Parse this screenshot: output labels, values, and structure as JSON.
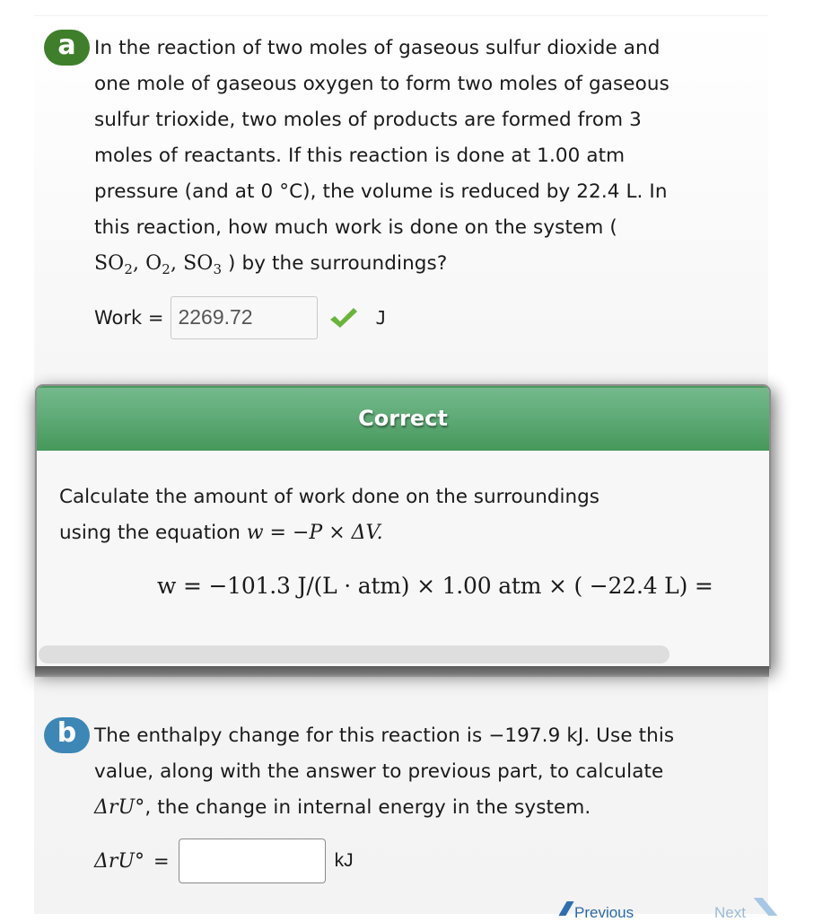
{
  "part_a": {
    "badge": "a",
    "question_lines": [
      "In the reaction of two moles of gaseous sulfur dioxide and",
      "one mole of gaseous oxygen to form two moles of gaseous",
      "sulfur trioxide, two moles of products are formed from 3",
      "moles of reactants. If this reaction is done at 1.00 atm",
      "pressure (and at 0 °C), the volume is reduced by 22.4 L. In",
      "this reaction, how much work is done on the system ("
    ],
    "species": {
      "s1": "SO",
      "s1_sub": "2",
      "s2": "O",
      "s2_sub": "2",
      "s3": "SO",
      "s3_sub": "3",
      "tail": ") by the surroundings?"
    },
    "answer_label": "Work =",
    "answer_value": "2269.72",
    "answer_status": "correct",
    "unit": "J"
  },
  "feedback": {
    "title": "Correct",
    "text_line1": "Calculate the amount of work done on the surroundings",
    "text_line2": "using the equation",
    "equation_inline": "w = −P × ΔV.",
    "equation_display": "w = −101.3 J/(L · atm) × 1.00 atm × ( −22.4 L) ="
  },
  "part_b": {
    "badge": "b",
    "question_lines": [
      "The enthalpy change for this reaction is −197.9 kJ. Use this",
      "value, along with the answer to previous part, to calculate"
    ],
    "line3_symbol": "ΔrU°",
    "line3_text": ", the change in internal energy in the system.",
    "answer_symbol": "ΔrU°",
    "answer_equals": "=",
    "answer_value": "",
    "unit": "kJ"
  },
  "navigation": {
    "previous": "Previous",
    "next": "Next"
  },
  "colors": {
    "badge_a": "#3f7f2b",
    "badge_b": "#3c87b5",
    "correct_header": "#5fae77",
    "checkmark": "#6ab43a"
  }
}
